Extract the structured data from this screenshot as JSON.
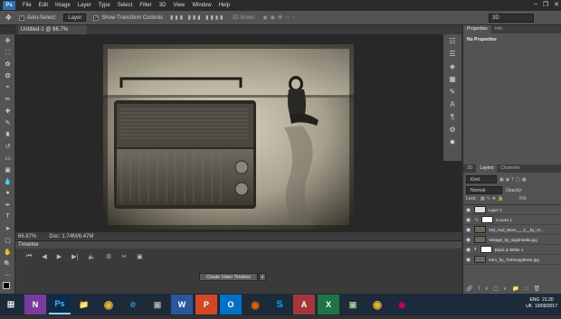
{
  "menubar": {
    "logo": "Ps",
    "items": [
      "File",
      "Edit",
      "Image",
      "Layer",
      "Type",
      "Select",
      "Filter",
      "3D",
      "View",
      "Window",
      "Help"
    ]
  },
  "options": {
    "auto_select": "Auto-Select:",
    "auto_select_target": "Layer",
    "show_transform": "Show Transform Controls",
    "mode_3d": "3D Mode:",
    "workspace": "3D"
  },
  "document": {
    "tab_title": "Untitled-1 @ 66.7% (RGB/8) *",
    "zoom": "66.67%",
    "doc_size": "Doc: 1.74M/6.47M"
  },
  "timeline": {
    "title": "Timeline",
    "create_button": "Create Video Timeline"
  },
  "properties": {
    "tab_properties": "Properties",
    "tab_info": "Info",
    "empty_text": "No Properties"
  },
  "layers": {
    "tab_3d": "3D",
    "tab_layers": "Layers",
    "tab_channels": "Channels",
    "filter_kind": "Kind",
    "blend_mode": "Normal",
    "opacity_label": "Opacity:",
    "lock_label": "Lock:",
    "fill_label": "Fill:",
    "items": [
      {
        "name": "Layer 1",
        "thumb": "light"
      },
      {
        "name": "Curves 1",
        "thumb": "mask"
      },
      {
        "name": "Old_And_Worn___2__by_Ar...",
        "thumb": "dark"
      },
      {
        "name": "Vintage_by_sigalmedia.jpg",
        "thumb": "dark"
      },
      {
        "name": "Black & White 1",
        "thumb": "mask"
      },
      {
        "name": "retro_by_TomsApplesee.jpg",
        "thumb": "dark"
      }
    ]
  },
  "taskbar": {
    "lang": "ENG",
    "region": "UK",
    "time": "21:20",
    "date": "19/09/2017"
  },
  "colors": {
    "ps_blue": "#2d6fb0",
    "panel_grey": "#535353",
    "canvas_bg": "#282828"
  }
}
